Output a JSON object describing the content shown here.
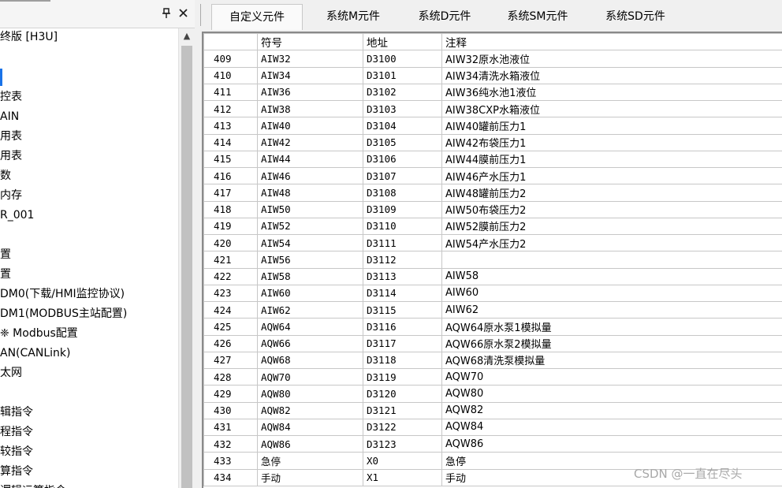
{
  "left_panel": {
    "pin_glyph": "ᵖ",
    "close_glyph": "✕",
    "tree": [
      "终版 [H3U]",
      "",
      "",
      "控表",
      "AIN",
      "用表",
      "用表",
      "数",
      "内存",
      "R_001",
      "",
      "置",
      "置",
      "DM0(下载/HMI监控协议)",
      "DM1(MODBUS主站配置)",
      "❈ Modbus配置",
      "AN(CANLink)",
      "太网",
      "",
      "辑指令",
      "程指令",
      "较指令",
      "算指令",
      "逻辑运算指令"
    ],
    "scroll_up_glyph": "▲"
  },
  "tabs": [
    "自定义元件",
    "系统M元件",
    "系统D元件",
    "系统SM元件",
    "系统SD元件"
  ],
  "active_tab": 0,
  "table": {
    "columns": [
      "",
      "符号",
      "地址",
      "注释"
    ],
    "rows": [
      [
        "409",
        "AIW32",
        "D3100",
        "AIW32原水池液位"
      ],
      [
        "410",
        "AIW34",
        "D3101",
        "AIW34清洗水箱液位"
      ],
      [
        "411",
        "AIW36",
        "D3102",
        "AIW36纯水池1液位"
      ],
      [
        "412",
        "AIW38",
        "D3103",
        "AIW38CXP水箱液位"
      ],
      [
        "413",
        "AIW40",
        "D3104",
        "AIW40罐前压力1"
      ],
      [
        "414",
        "AIW42",
        "D3105",
        "AIW42布袋压力1"
      ],
      [
        "415",
        "AIW44",
        "D3106",
        "AIW44膜前压力1"
      ],
      [
        "416",
        "AIW46",
        "D3107",
        "AIW46产水压力1"
      ],
      [
        "417",
        "AIW48",
        "D3108",
        "AIW48罐前压力2"
      ],
      [
        "418",
        "AIW50",
        "D3109",
        "AIW50布袋压力2"
      ],
      [
        "419",
        "AIW52",
        "D3110",
        "AIW52膜前压力2"
      ],
      [
        "420",
        "AIW54",
        "D3111",
        "AIW54产水压力2"
      ],
      [
        "421",
        "AIW56",
        "D3112",
        ""
      ],
      [
        "422",
        "AIW58",
        "D3113",
        "AIW58"
      ],
      [
        "423",
        "AIW60",
        "D3114",
        "AIW60"
      ],
      [
        "424",
        "AIW62",
        "D3115",
        "AIW62"
      ],
      [
        "425",
        "AQW64",
        "D3116",
        "AQW64原水泵1模拟量"
      ],
      [
        "426",
        "AQW66",
        "D3117",
        "AQW66原水泵2模拟量"
      ],
      [
        "427",
        "AQW68",
        "D3118",
        "AQW68清洗泵模拟量"
      ],
      [
        "428",
        "AQW70",
        "D3119",
        "AQW70"
      ],
      [
        "429",
        "AQW80",
        "D3120",
        "AQW80"
      ],
      [
        "430",
        "AQW82",
        "D3121",
        "AQW82"
      ],
      [
        "431",
        "AQW84",
        "D3122",
        "AQW84"
      ],
      [
        "432",
        "AQW86",
        "D3123",
        "AQW86"
      ],
      [
        "433",
        "急停",
        "X0",
        "急停"
      ],
      [
        "434",
        "手动",
        "X1",
        "手动"
      ]
    ]
  },
  "watermark": "CSDN @一直在尽头"
}
